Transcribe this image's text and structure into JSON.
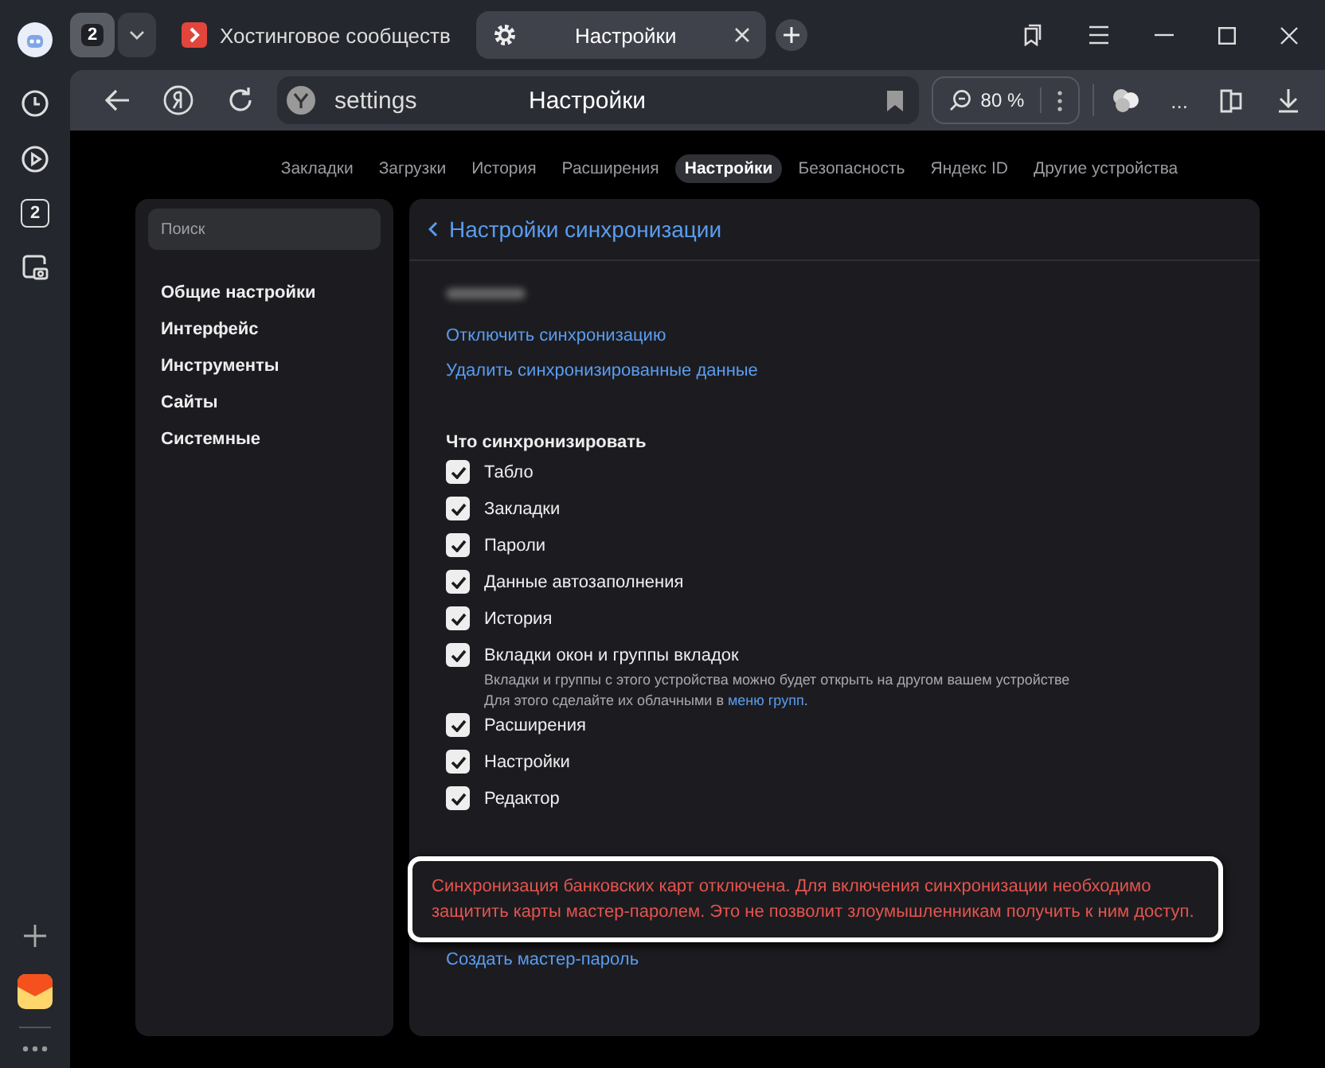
{
  "sidebar": {
    "tab_count": "2"
  },
  "tabs": [
    {
      "title": "Хостинговое сообществ",
      "selected": false
    },
    {
      "title": "Настройки",
      "selected": true
    }
  ],
  "tab_group_count": "2",
  "address_bar": {
    "url": "settings",
    "page_title": "Настройки",
    "zoom": "80 %"
  },
  "toolbar": {
    "more": "..."
  },
  "nav": [
    {
      "label": "Закладки",
      "selected": false
    },
    {
      "label": "Загрузки",
      "selected": false
    },
    {
      "label": "История",
      "selected": false
    },
    {
      "label": "Расширения",
      "selected": false
    },
    {
      "label": "Настройки",
      "selected": true
    },
    {
      "label": "Безопасность",
      "selected": false
    },
    {
      "label": "Яндекс ID",
      "selected": false
    },
    {
      "label": "Другие устройства",
      "selected": false
    }
  ],
  "settings_menu": {
    "search_placeholder": "Поиск",
    "items": [
      "Общие настройки",
      "Интерфейс",
      "Инструменты",
      "Сайты",
      "Системные"
    ]
  },
  "panel": {
    "title": "Настройки синхронизации",
    "links": [
      "Отключить синхронизацию",
      "Удалить синхронизированные данные"
    ],
    "section_title": "Что синхронизировать",
    "options": [
      {
        "label": "Табло",
        "checked": true
      },
      {
        "label": "Закладки",
        "checked": true
      },
      {
        "label": "Пароли",
        "checked": true
      },
      {
        "label": "Данные автозаполнения",
        "checked": true
      },
      {
        "label": "История",
        "checked": true
      },
      {
        "label": "Вкладки окон и группы вкладок",
        "checked": true,
        "description": "Вкладки и группы с этого устройства можно будет открыть на другом вашем устройстве",
        "note": {
          "before": "Для этого сделайте их облачными в ",
          "link": "меню групп",
          "after": "."
        }
      },
      {
        "label": "Расширения",
        "checked": true
      },
      {
        "label": "Настройки",
        "checked": true
      },
      {
        "label": "Редактор",
        "checked": true
      }
    ],
    "warning": "Синхронизация банковских карт отключена. Для включения синхронизации необходимо защитить карты мастер-паролем. Это не позволит злоумышленникам получить к ним доступ.",
    "warning_link": "Создать мастер-пароль"
  }
}
